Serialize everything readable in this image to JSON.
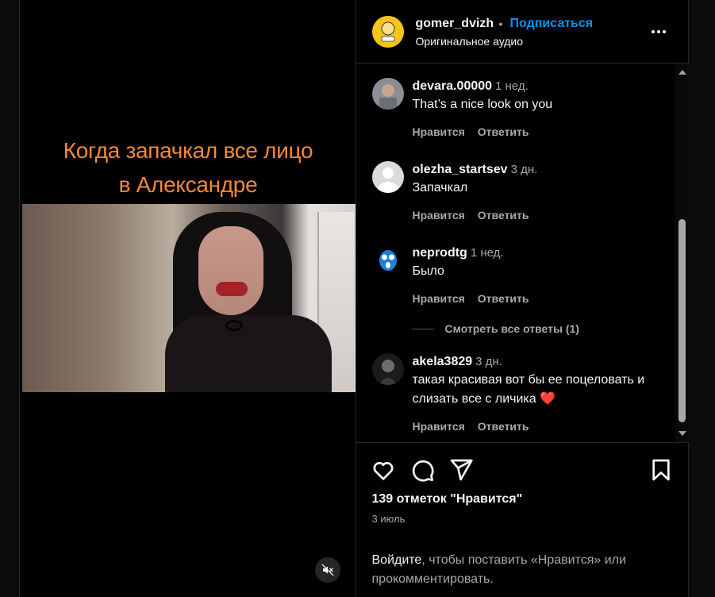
{
  "video": {
    "caption_line1": "Когда запачкал все лицо",
    "caption_line2": "в Александре",
    "caption_color": "#f08a36",
    "mute_icon": "speaker-muted-icon"
  },
  "header": {
    "username": "gomer_dvizh",
    "dot": "•",
    "follow_label": "Подписаться",
    "audio_label": "Оригинальное аудио",
    "more_icon": "more-dots-icon",
    "accent_color": "#0095f6"
  },
  "comments": [
    {
      "username": "devara.00000",
      "time": "1 нед.",
      "text": "That’s a nice look on you",
      "like_label": "Нравится",
      "reply_label": "Ответить"
    },
    {
      "username": "olezha_startsev",
      "time": "3 дн.",
      "text": "Запачкал",
      "like_label": "Нравится",
      "reply_label": "Ответить"
    },
    {
      "username": "neprodtg",
      "time": "1 нед.",
      "text": "Было",
      "like_label": "Нравится",
      "reply_label": "Ответить",
      "view_replies": "Смотреть все ответы (1)"
    },
    {
      "username": "akela3829",
      "time": "3 дн.",
      "text": "такая красивая вот бы ее поцеловать и слизать все с личика",
      "emoji": "❤️",
      "like_label": "Нравится",
      "reply_label": "Ответить"
    }
  ],
  "actions": {
    "like_icon": "heart-icon",
    "comment_icon": "comment-bubble-icon",
    "share_icon": "paper-plane-icon",
    "save_icon": "bookmark-icon",
    "likes_text": "139 отметок \"Нравится\"",
    "date_text": "3 июль"
  },
  "login": {
    "link_text": "Войдите",
    "rest_text": ", чтобы поставить «Нравится» или прокомментировать."
  }
}
